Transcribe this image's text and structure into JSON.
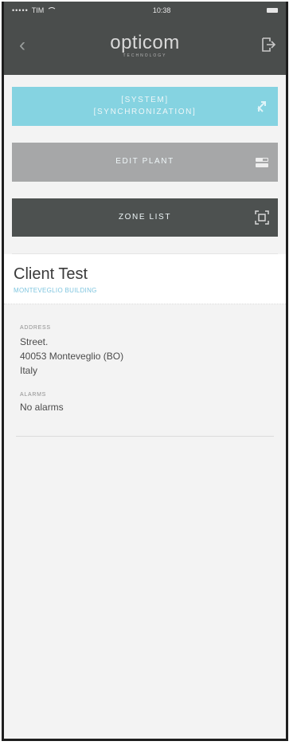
{
  "status_bar": {
    "carrier": "TIM",
    "time": "10:38"
  },
  "nav": {
    "brand_name": "opticom",
    "brand_sub": "TECHNOLOGY"
  },
  "buttons": [
    {
      "label_line1": "[SYSTEM]",
      "label_line2": "[SYNCHRONIZATION]"
    },
    {
      "label": "EDIT PLANT"
    },
    {
      "label": "ZONE LIST"
    }
  ],
  "client": {
    "name": "Client Test",
    "subtitle": "MONTEVEGLIO BUILDING"
  },
  "address": {
    "label": "ADDRESS",
    "line1": "Street.",
    "line2": "40053 Monteveglio (BO)",
    "line3": "Italy"
  },
  "alarms": {
    "label": "ALARMS",
    "value": "No alarms"
  },
  "colors": {
    "header": "#4a4d4c",
    "sync_button": "#85d3e1",
    "edit_button": "#a6a7a8",
    "zone_button": "#4d5150",
    "accent_text": "#7ec5df"
  },
  "icons": {
    "back": "chevron-left-icon",
    "logout": "logout-icon",
    "sync": "sync-icon",
    "edit": "edit-plant-icon",
    "zone": "zone-list-icon"
  }
}
